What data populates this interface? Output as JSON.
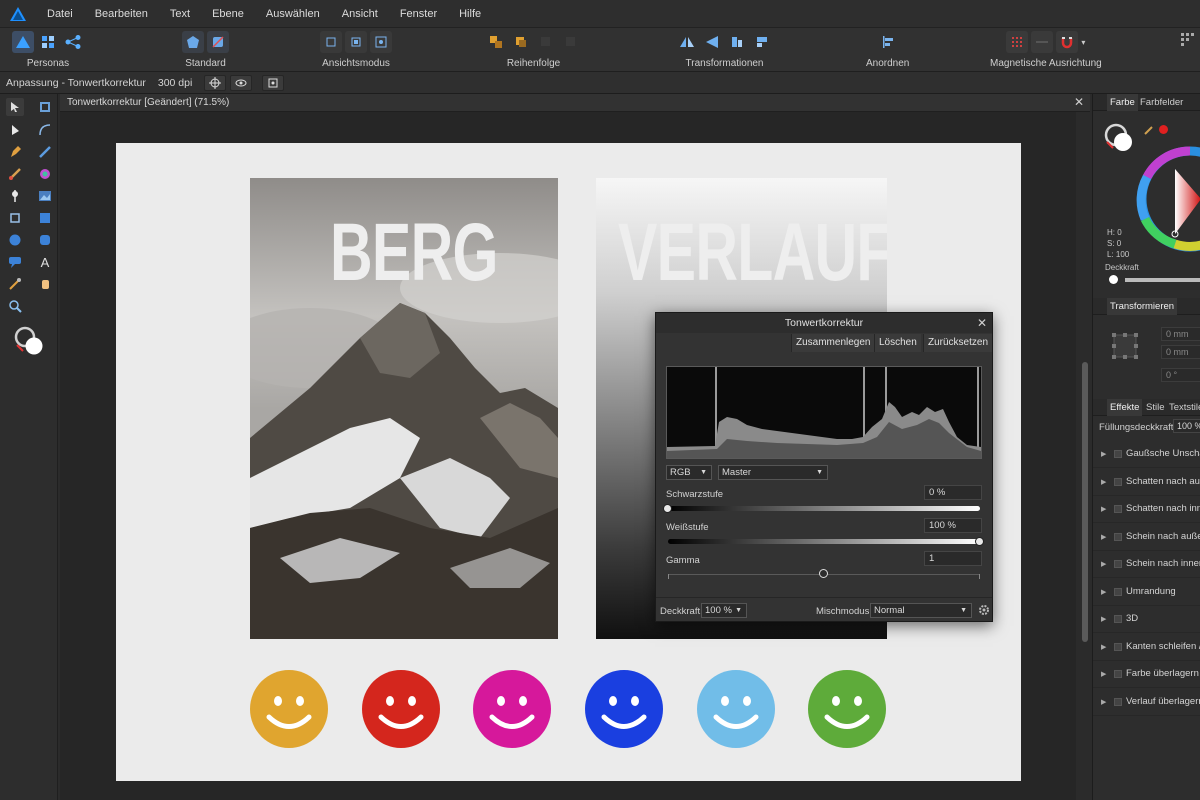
{
  "menubar": {
    "items": [
      "Datei",
      "Bearbeiten",
      "Text",
      "Ebene",
      "Auswählen",
      "Ansicht",
      "Fenster",
      "Hilfe"
    ]
  },
  "toolbar": {
    "groups": [
      {
        "label": "Personas"
      },
      {
        "label": "Standard"
      },
      {
        "label": "Ansichtsmodus"
      },
      {
        "label": "Reihenfolge"
      },
      {
        "label": "Transformationen"
      },
      {
        "label": "Anordnen"
      },
      {
        "label": "Magnetische Ausrichtung"
      }
    ]
  },
  "contextbar": {
    "title": "Anpassung - Tonwertkorrektur",
    "dpi": "300 dpi"
  },
  "document": {
    "tab_title": "Tonwertkorrektur [Geändert] (71.5%)",
    "close": "✕"
  },
  "artwork": {
    "word_left": "BERG",
    "word_right": "VERLAUF",
    "smiley_colors": [
      "#e0a52f",
      "#d4261d",
      "#d6189b",
      "#1a3fe0",
      "#71bde8",
      "#5eab3a"
    ]
  },
  "dialog": {
    "title": "Tonwertkorrektur",
    "close": "✕",
    "buttons": [
      "Zusammenlegen",
      "Löschen",
      "Zurücksetzen"
    ],
    "channel_mode": "RGB",
    "channel": "Master",
    "black_level_label": "Schwarzstufe",
    "black_level_value": "0 %",
    "black_level_fraction": 0,
    "white_level_label": "Weißstufe",
    "white_level_value": "100 %",
    "white_level_fraction": 1,
    "gamma_label": "Gamma",
    "gamma_value": "1",
    "opacity_label": "Deckkraft:",
    "opacity_value": "100 %",
    "blend_label": "Mischmodus:",
    "blend_value": "Normal"
  },
  "right_panel": {
    "color_tabs": [
      "Farbe",
      "Farbfelder"
    ],
    "hsl": {
      "h": "H: 0",
      "s": "S: 0",
      "l": "L: 100"
    },
    "opacity_label": "Deckkraft",
    "transform_tab": "Transformieren",
    "transform_fields": [
      "0 mm",
      "0 mm",
      "0 °"
    ],
    "fx_tabs": [
      "Effekte",
      "Stile",
      "Textstile"
    ],
    "fill_opacity_label": "Füllungsdeckkraft:",
    "fill_opacity_value": "100 %",
    "effects": [
      "Gaußsche Unschärfe",
      "Schatten nach außen",
      "Schatten nach innen",
      "Schein nach außen",
      "Schein nach innen",
      "Umrandung",
      "3D",
      "Kanten schleifen / R",
      "Farbe überlagern",
      "Verlauf überlagern"
    ]
  }
}
